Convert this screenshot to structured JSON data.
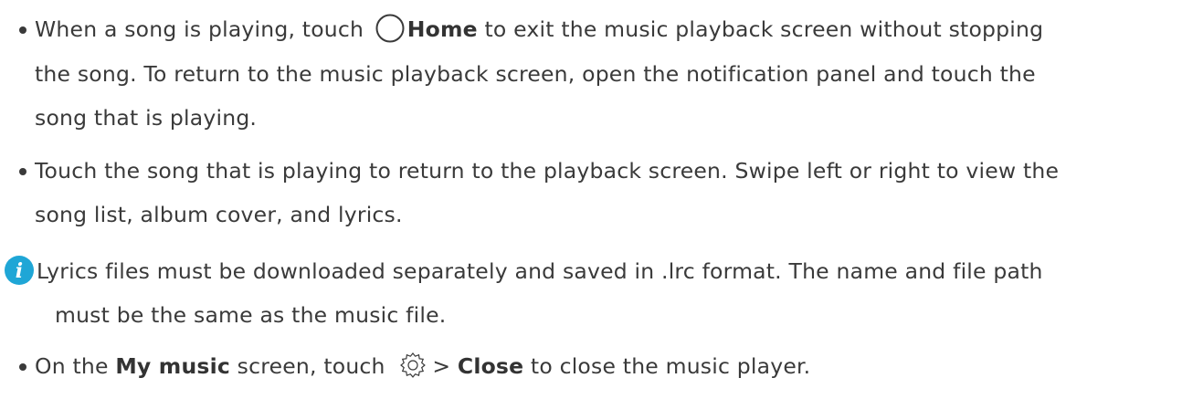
{
  "bullet1": {
    "line1_a": "When a song is playing, touch",
    "home_label": "Home",
    "line1_b": "to exit the music playback screen without stopping",
    "line2": "the song. To return to the music playback screen, open the notification panel and touch the",
    "line3": "song that is playing."
  },
  "bullet2": {
    "line1": "Touch the song that is playing to return to the playback screen. Swipe left or right to view the",
    "line2": "song list, album cover, and lyrics."
  },
  "note": {
    "icon": "info-icon",
    "line1": "Lyrics files must be downloaded separately and saved in .lrc format. The name and file path",
    "line2": "must be the same as the music file."
  },
  "bullet3": {
    "prefix": "On the",
    "my_music_label": "My music",
    "mid": "screen, touch",
    "separator": ">",
    "close_label": "Close",
    "suffix": "to close the music player."
  },
  "colors": {
    "text": "#3a3a3a",
    "note_icon": "#1fa6d6"
  }
}
